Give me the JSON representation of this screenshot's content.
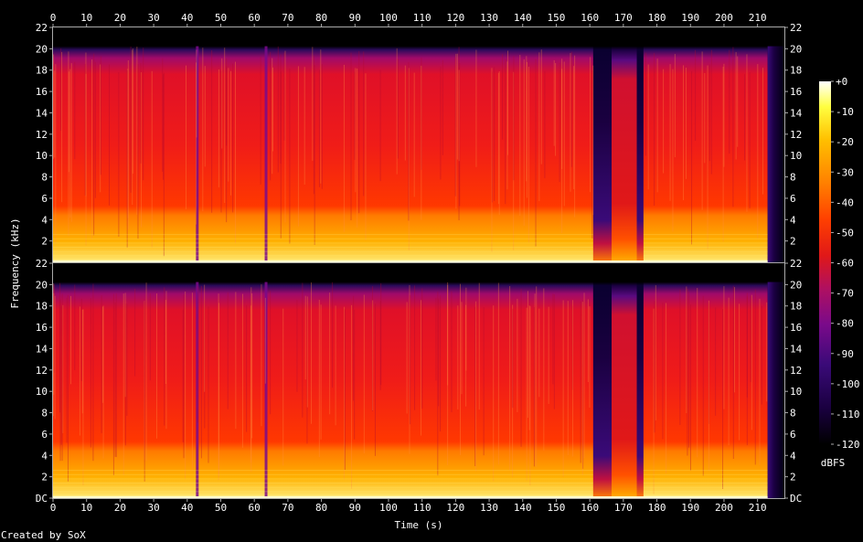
{
  "chart_data": {
    "type": "heatmap",
    "title": "",
    "xlabel": "Time (s)",
    "ylabel": "Frequency (kHz)",
    "x_ticks": [
      0,
      10,
      20,
      30,
      40,
      50,
      60,
      70,
      80,
      90,
      100,
      110,
      120,
      130,
      140,
      150,
      160,
      170,
      180,
      190,
      200,
      210
    ],
    "xlim": [
      0,
      218
    ],
    "y_ticks": [
      "DC",
      "2",
      "4",
      "6",
      "8",
      "10",
      "12",
      "14",
      "16",
      "18",
      "20",
      "22"
    ],
    "ylim": [
      0,
      22
    ],
    "channels": 2,
    "colorbar": {
      "label": "dBFS",
      "ticks": [
        "+0",
        "-10",
        "-20",
        "-30",
        "-40",
        "-50",
        "-60",
        "-70",
        "-80",
        "-90",
        "-100",
        "-110",
        "-120"
      ],
      "range": [
        -120,
        0
      ],
      "colors": [
        "#000000",
        "#1a0040",
        "#3a0a78",
        "#7a0a8a",
        "#b01060",
        "#e01818",
        "#ff4000",
        "#ff8000",
        "#ffc000",
        "#ffff40",
        "#ffffff"
      ]
    },
    "features": {
      "energy_cutoff_khz": 20,
      "content_end_s": 213,
      "quiet_section_s": [
        161,
        176
      ],
      "dips_s": [
        43,
        63.5
      ]
    },
    "footer": "Created by SoX"
  }
}
